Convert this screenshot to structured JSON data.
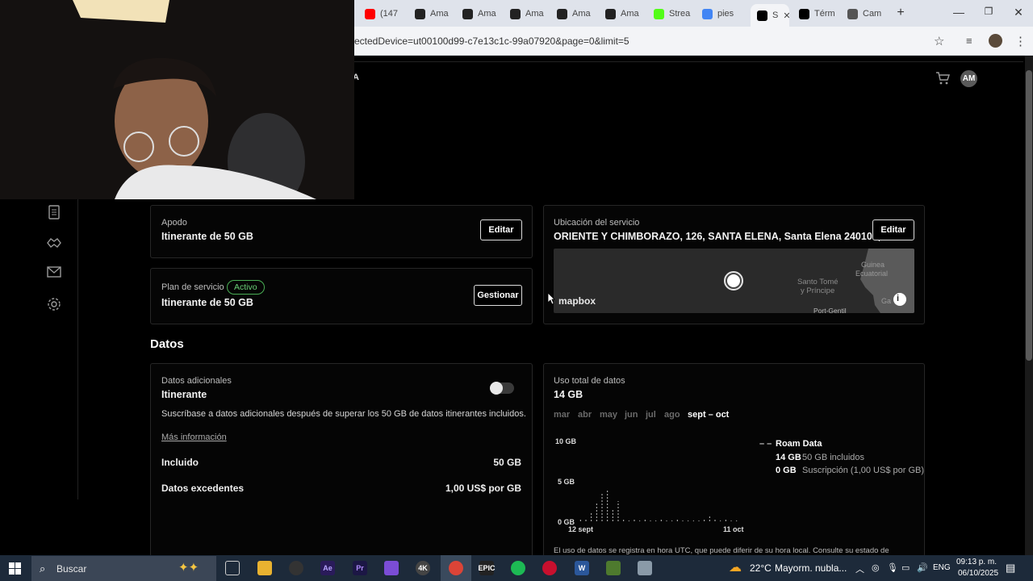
{
  "browser": {
    "tabs": [
      {
        "label": "(147",
        "icon": "youtube-icon",
        "color": "#ff0000"
      },
      {
        "label": "Ama",
        "icon": "amazon-icon",
        "color": "#222222"
      },
      {
        "label": "Ama",
        "icon": "amazon-icon",
        "color": "#222222"
      },
      {
        "label": "Ama",
        "icon": "amazon-icon",
        "color": "#222222"
      },
      {
        "label": "Ama",
        "icon": "amazon-icon",
        "color": "#222222"
      },
      {
        "label": "Ama",
        "icon": "amazon-icon",
        "color": "#222222"
      },
      {
        "label": "Strea",
        "icon": "kick-icon",
        "color": "#53fc18"
      },
      {
        "label": "pies",
        "icon": "google-icon",
        "color": "#4285f4"
      },
      {
        "label": "S",
        "icon": "starlink-icon",
        "color": "#000000"
      },
      {
        "label": "Térm",
        "icon": "starlink-icon",
        "color": "#000000"
      },
      {
        "label": "Cam",
        "icon": "globe-icon",
        "color": "#555555"
      }
    ],
    "url": "ectedDevice=ut00100d99-c7e13c1c-99a07920&page=0&limit=5",
    "avatar_initials": "AM"
  },
  "service": {
    "nickname_label": "Apodo",
    "nickname_value": "Itinerante de 50 GB",
    "edit_label": "Editar",
    "plan_label": "Plan de servicio",
    "plan_status": "Activo",
    "plan_value": "Itinerante de 50 GB",
    "manage_label": "Gestionar",
    "location_label": "Ubicación del servicio",
    "location_value": "ORIENTE Y CHIMBORAZO, 126, SANTA ELENA, Santa Elena 240104, EC",
    "location_edit_label": "Editar",
    "map": {
      "logo": "mapbox",
      "place1": "Guinea",
      "place2": "Ecuatorial",
      "place3": "Santo Tomé",
      "place4": "y Príncipe",
      "place5": "Port-Gentil",
      "place6": "Ga"
    }
  },
  "data_section": {
    "heading": "Datos",
    "additional_label": "Datos adicionales",
    "additional_value": "Itinerante",
    "toggle_on": false,
    "description": "Suscríbase a datos adicionales después de superar los 50 GB de datos itinerantes incluidos.",
    "more_info": "Más información",
    "included_label": "Incluido",
    "included_value": "50 GB",
    "overage_label": "Datos excedentes",
    "overage_value": "1,00 US$ por GB"
  },
  "usage": {
    "label": "Uso total de datos",
    "total": "14 GB",
    "months": [
      "mar",
      "abr",
      "may",
      "jun",
      "jul",
      "ago",
      "sept – oct"
    ],
    "selected_month": "sept – oct",
    "legend_dash": "– –",
    "legend_title": "Roam Data",
    "row1_value": "14 GB",
    "row1_desc": "50 GB incluidos",
    "row2_value": "0 GB",
    "row2_desc": "Suscripción (1,00 US$ por GB)",
    "footer": "El uso de datos se registra en hora UTC, que puede diferir de su hora local. Consulte su estado de"
  },
  "chart_data": {
    "type": "bar",
    "ylim": [
      0,
      10
    ],
    "yticks": [
      "10 GB",
      "5 GB",
      "0 GB"
    ],
    "xticks": [
      "12 sept",
      "11 oct"
    ],
    "series": [
      {
        "name": "Roam Data",
        "values": [
          0.2,
          0.3,
          1.1,
          2.3,
          3.4,
          3.9,
          1.5,
          2.5,
          0.2,
          0.1,
          0.2,
          0.1,
          0.2,
          0.1,
          0.1,
          0.2,
          0.1,
          0.1,
          0.2,
          0.1,
          0.1,
          0.1,
          0.1,
          0.2,
          0.8,
          0.2,
          0.1,
          0.4,
          0.1,
          0.1
        ]
      }
    ]
  },
  "taskbar": {
    "search_placeholder": "Buscar",
    "weather": "22°C",
    "weather_desc": "Mayorm. nubla...",
    "lang": "ENG",
    "time": "09:13 p. m.",
    "date": "06/10/2025"
  }
}
